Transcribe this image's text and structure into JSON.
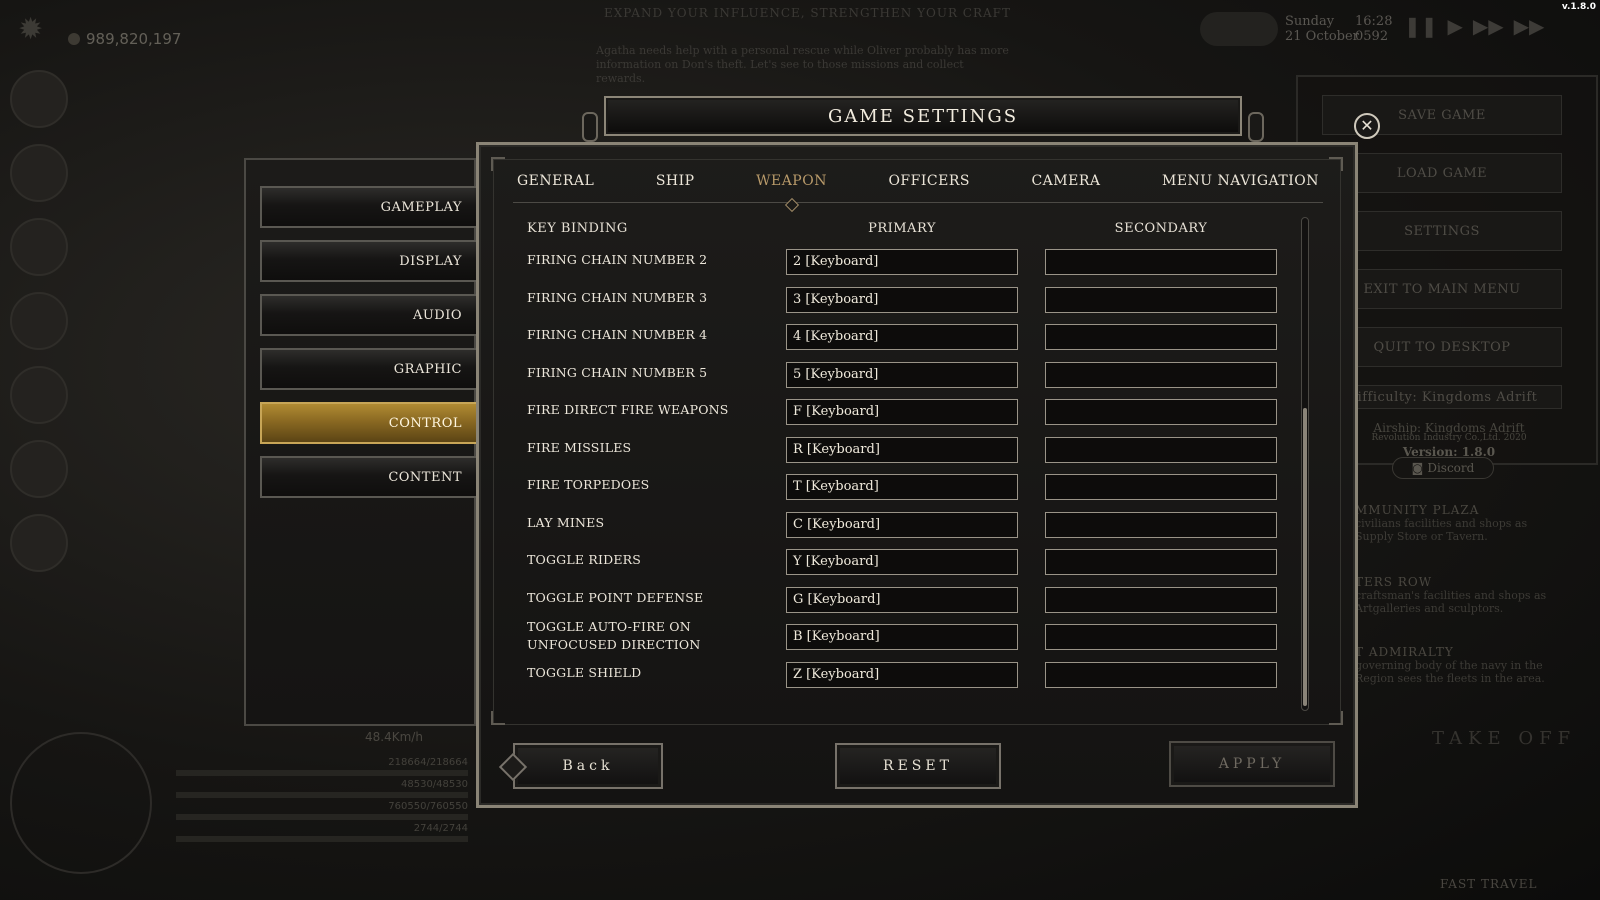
{
  "version": "v.1.8.0",
  "hud": {
    "money": "989,820,197",
    "day": "Sunday",
    "date": "21  October",
    "time": "16:28",
    "year": "0592",
    "speed": "48.4Km/h",
    "stats": [
      "218664/218664",
      "48530/48530",
      "760550/760550",
      "2744/2744"
    ],
    "notice_title": "EXPAND YOUR INFLUENCE, STRENGTHEN YOUR CRAFT",
    "notice_text": "Agatha needs help with a personal rescue while Oliver probably has more information on Don's theft. Let's see to those missions and collect rewards.",
    "take_off": "TAKE OFF",
    "fast_travel": "FAST TRAVEL"
  },
  "right_menu": {
    "buttons": [
      "SAVE GAME",
      "LOAD GAME",
      "SETTINGS",
      "EXIT TO MAIN MENU",
      "QUIT TO DESKTOP"
    ],
    "difficulty": "Difficulty: Kingdoms Adrift",
    "airship": "Airship: Kingdoms Adrift",
    "company": "Revolution Industry Co.,Ltd. 2020",
    "version": "Version: 1.8.0",
    "discord": "Discord",
    "notes": [
      {
        "heading": "MMUNITY PLAZA",
        "text": "civilians facilities and shops as Supply Store or Tavern."
      },
      {
        "heading": "TERS ROW",
        "text": "craftsman's facilities and shops as Artgalleries and sculptors."
      },
      {
        "heading": "T ADMIRALTY",
        "text": "governing body of the navy in the Region sees the fleets in the area."
      }
    ]
  },
  "settings": {
    "title": "GAME SETTINGS",
    "categories": [
      {
        "label": "GAMEPLAY",
        "active": false
      },
      {
        "label": "DISPLAY",
        "active": false
      },
      {
        "label": "AUDIO",
        "active": false
      },
      {
        "label": "GRAPHIC",
        "active": false
      },
      {
        "label": "CONTROL",
        "active": true
      },
      {
        "label": "CONTENT",
        "active": false
      }
    ],
    "tabs": [
      {
        "label": "GENERAL",
        "active": false
      },
      {
        "label": "SHIP",
        "active": false
      },
      {
        "label": "WEAPON",
        "active": true
      },
      {
        "label": "OFFICERS",
        "active": false
      },
      {
        "label": "CAMERA",
        "active": false
      },
      {
        "label": "MENU NAVIGATION",
        "active": false
      }
    ],
    "headers": {
      "key": "KEY BINDING",
      "primary": "PRIMARY",
      "secondary": "SECONDARY"
    },
    "bindings": [
      {
        "action": "FIRING CHAIN NUMBER 2",
        "primary": "2 [Keyboard]",
        "secondary": ""
      },
      {
        "action": "FIRING CHAIN NUMBER 3",
        "primary": "3 [Keyboard]",
        "secondary": ""
      },
      {
        "action": "FIRING CHAIN NUMBER 4",
        "primary": "4 [Keyboard]",
        "secondary": ""
      },
      {
        "action": "FIRING CHAIN NUMBER 5",
        "primary": "5 [Keyboard]",
        "secondary": ""
      },
      {
        "action": "FIRE DIRECT FIRE WEAPONS",
        "primary": "F [Keyboard]",
        "secondary": ""
      },
      {
        "action": "FIRE MISSILES",
        "primary": "R [Keyboard]",
        "secondary": ""
      },
      {
        "action": "FIRE TORPEDOES",
        "primary": "T [Keyboard]",
        "secondary": ""
      },
      {
        "action": "LAY MINES",
        "primary": "C [Keyboard]",
        "secondary": ""
      },
      {
        "action": "TOGGLE RIDERS",
        "primary": "Y [Keyboard]",
        "secondary": ""
      },
      {
        "action": "TOGGLE POINT DEFENSE",
        "primary": "G [Keyboard]",
        "secondary": ""
      },
      {
        "action": "TOGGLE AUTO-FIRE ON UNFOCUSED DIRECTION",
        "primary": "B [Keyboard]",
        "secondary": ""
      },
      {
        "action": "TOGGLE SHIELD",
        "primary": "Z [Keyboard]",
        "secondary": ""
      }
    ],
    "footer": {
      "back": "Back",
      "reset": "RESET",
      "apply": "APPLY"
    },
    "close_glyph": "✕"
  },
  "icons": {
    "sun": "sun-icon",
    "close": "close-icon",
    "discord": "discord-icon"
  }
}
